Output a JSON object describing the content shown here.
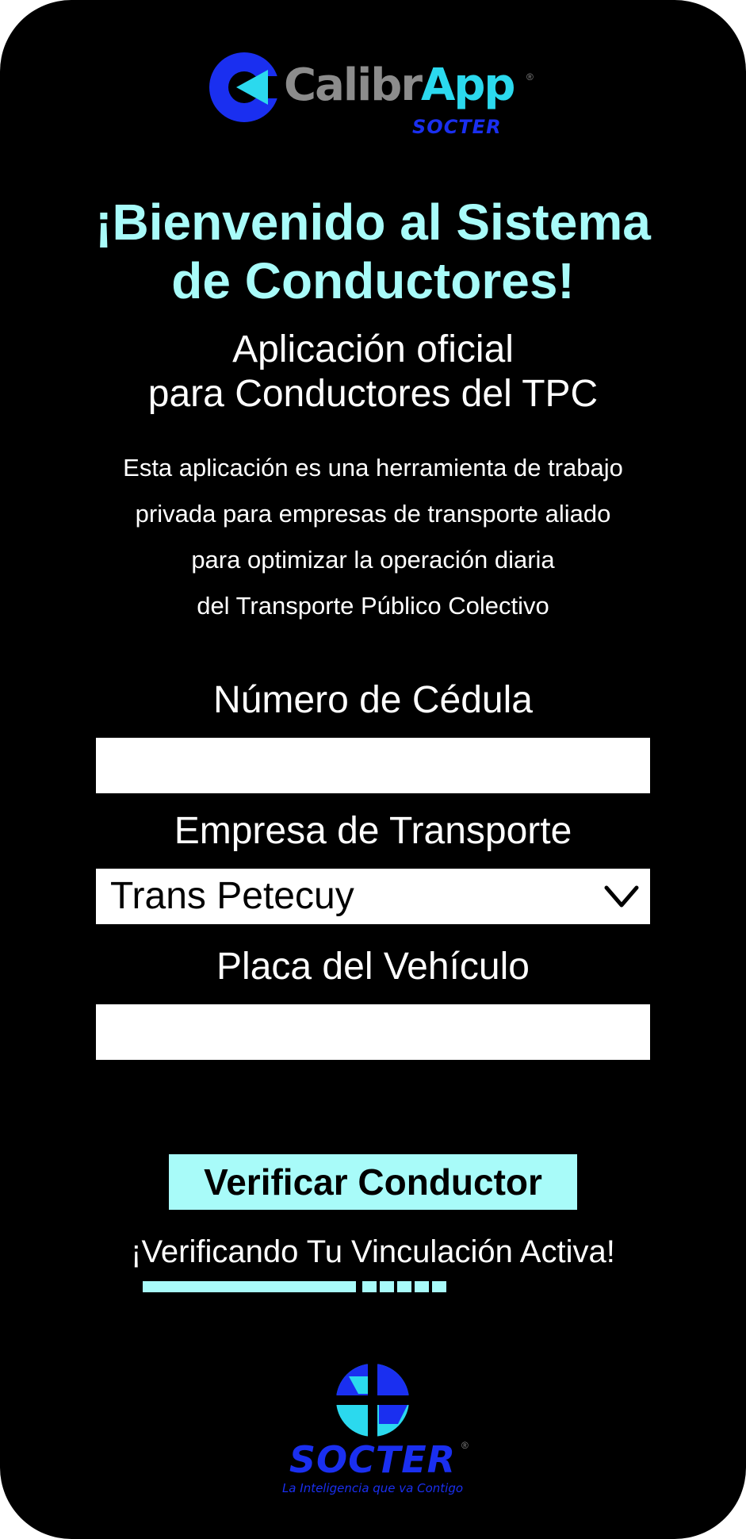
{
  "brand": {
    "app_name_prefix": "Calibr",
    "app_name_accent": "App",
    "app_sub": "SOCTER",
    "registered": "®",
    "colors": {
      "blue": "#1a2ff0",
      "cyan": "#2bd9ee",
      "gray": "#8c8c8c",
      "accent": "#a8fbf9"
    }
  },
  "header": {
    "welcome_line1": "¡Bienvenido al Sistema",
    "welcome_line2": "de Conductores!",
    "subtitle_line1": "Aplicación oficial",
    "subtitle_line2": "para Conductores del TPC",
    "description_lines": [
      "Esta aplicación es una herramienta de trabajo",
      "privada para empresas de transporte aliado",
      "para optimizar la operación diaria",
      "del Transporte Público Colectivo"
    ]
  },
  "form": {
    "cedula_label": "Número de Cédula",
    "cedula_value": "",
    "empresa_label": "Empresa de Transporte",
    "empresa_selected": "Trans Petecuy",
    "placa_label": "Placa del Vehículo",
    "placa_value": "",
    "submit_label": "Verificar Conductor"
  },
  "status": {
    "message": "¡Verificando Tu Vinculación Activa!",
    "progress": 0.78,
    "pending_segments": 5
  },
  "footer": {
    "logo_text": "SOCTER",
    "registered": "®",
    "tagline": "La Inteligencia que va Contigo"
  },
  "icons": {
    "dropdown": "chevron-down-icon"
  }
}
